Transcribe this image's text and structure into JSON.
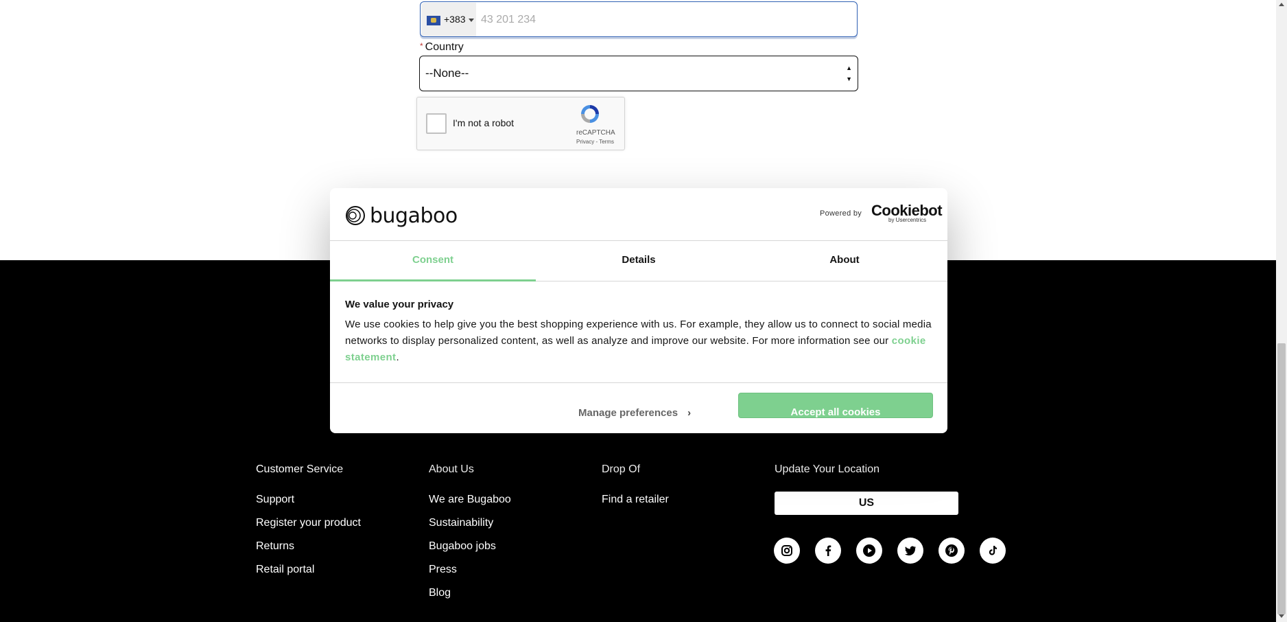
{
  "form": {
    "phone": {
      "dial_code": "+383",
      "placeholder": "43 201 234"
    },
    "country": {
      "required_mark": "*",
      "label": "Country",
      "value": "--None--",
      "up": "▲",
      "down": "▼"
    },
    "recaptcha": {
      "label": "I'm not a robot",
      "brand": "reCAPTCHA",
      "links": "Privacy - Terms"
    }
  },
  "cookie_dialog": {
    "logo_text": "bugaboo",
    "powered_by": "Powered by",
    "provider": "Cookiebot",
    "provider_sub": "by Usercentrics",
    "tabs": [
      "Consent",
      "Details",
      "About"
    ],
    "active_tab": "Consent",
    "title": "We value your privacy",
    "body": "We use cookies to help give you the best shopping experience with us. For example, they allow us to connect to social media networks to display personalized content, as well as analyze and improve our website. For more information see our",
    "link": "cookie statement",
    "body_end": ".",
    "manage_label": "Manage preferences",
    "manage_chevron": "›",
    "accept_label": "Accept all cookies",
    "accent_color": "#7ed08f"
  },
  "footer": {
    "columns": [
      {
        "title": "Customer Service",
        "links": [
          "Support",
          "Register your product",
          "Returns",
          "Retail portal"
        ]
      },
      {
        "title": "About Us",
        "links": [
          "We are Bugaboo",
          "Sustainability",
          "Bugaboo jobs",
          "Press",
          "Blog"
        ]
      },
      {
        "title": "Drop Of",
        "links": [
          "Find a retailer"
        ]
      },
      {
        "title": "Update Your Location",
        "links": []
      }
    ],
    "location_value": "US",
    "social_icons": [
      "instagram-icon",
      "facebook-icon",
      "youtube-icon",
      "twitter-icon",
      "pinterest-icon",
      "tiktok-icon"
    ]
  }
}
